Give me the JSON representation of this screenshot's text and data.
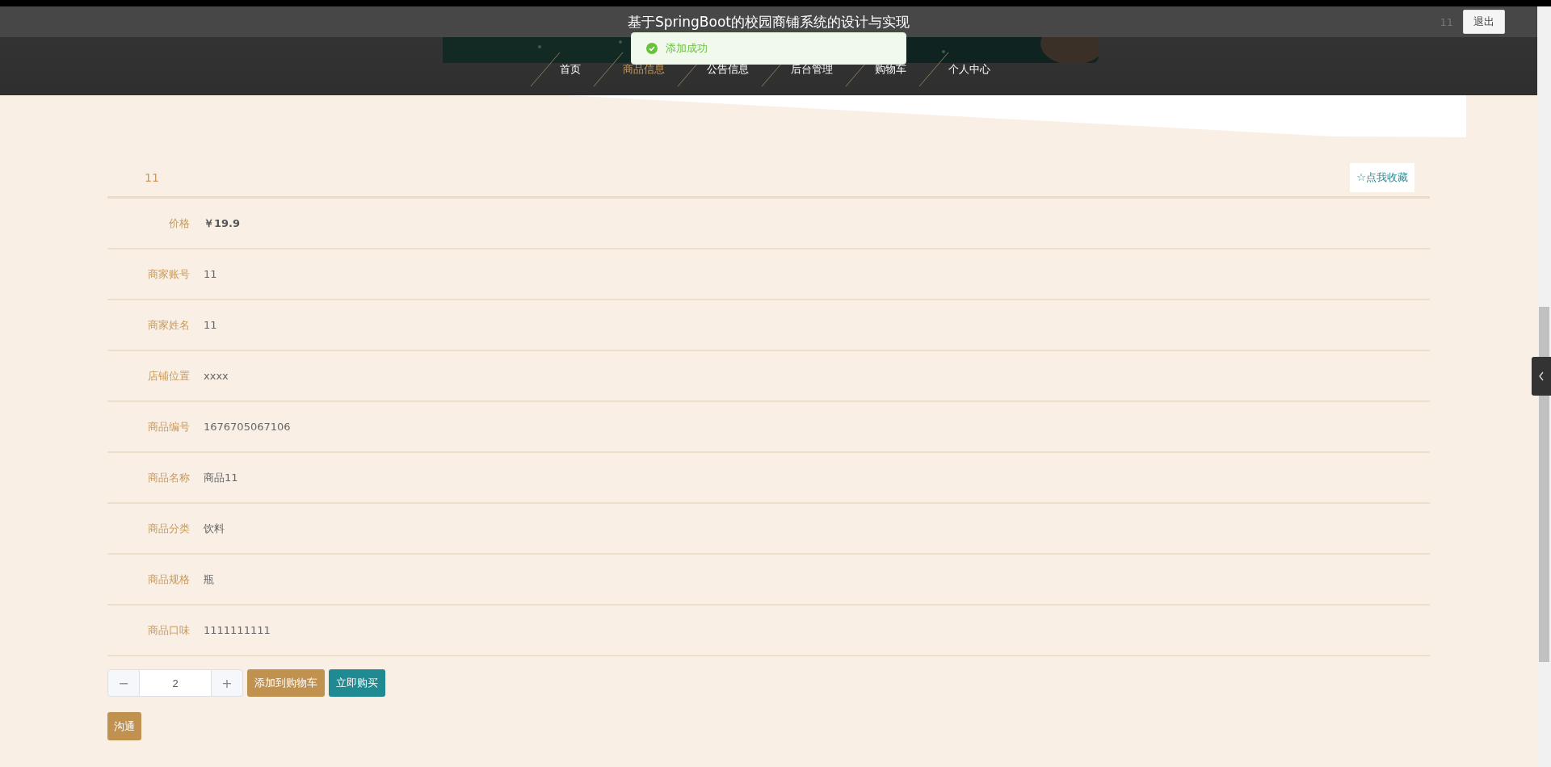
{
  "header": {
    "title": "基于SpringBoot的校园商铺系统的设计与实现",
    "username": "11",
    "logout_button": "退出"
  },
  "toast": {
    "message": "添加成功"
  },
  "nav": [
    {
      "label": "首页",
      "selected": false
    },
    {
      "label": "商品信息",
      "selected": true
    },
    {
      "label": "公告信息",
      "selected": false
    },
    {
      "label": "后台管理",
      "selected": false
    },
    {
      "label": "购物车",
      "selected": false
    },
    {
      "label": "个人中心",
      "selected": false
    }
  ],
  "product": {
    "title": "11",
    "favorite_button": "☆点我收藏",
    "fields": [
      {
        "label": "价格",
        "value": "￥19.9",
        "kind": "price"
      },
      {
        "label": "商家账号",
        "value": "11",
        "kind": "text"
      },
      {
        "label": "商家姓名",
        "value": "11",
        "kind": "text"
      },
      {
        "label": "店铺位置",
        "value": "xxxx",
        "kind": "text"
      },
      {
        "label": "商品编号",
        "value": "1676705067106",
        "kind": "text"
      },
      {
        "label": "商品名称",
        "value": "商品11",
        "kind": "text"
      },
      {
        "label": "商品分类",
        "value": "饮料",
        "kind": "text"
      },
      {
        "label": "商品规格",
        "value": "瓶",
        "kind": "text"
      },
      {
        "label": "商品口味",
        "value": "1111111111",
        "kind": "text"
      }
    ]
  },
  "quantity": {
    "decrement": "−",
    "value": "2",
    "increment": "+"
  },
  "actions": [
    {
      "label": "添加到购物车",
      "kind": "cart"
    },
    {
      "label": "立即购买",
      "kind": "buy"
    }
  ],
  "chat_button": "沟通"
}
